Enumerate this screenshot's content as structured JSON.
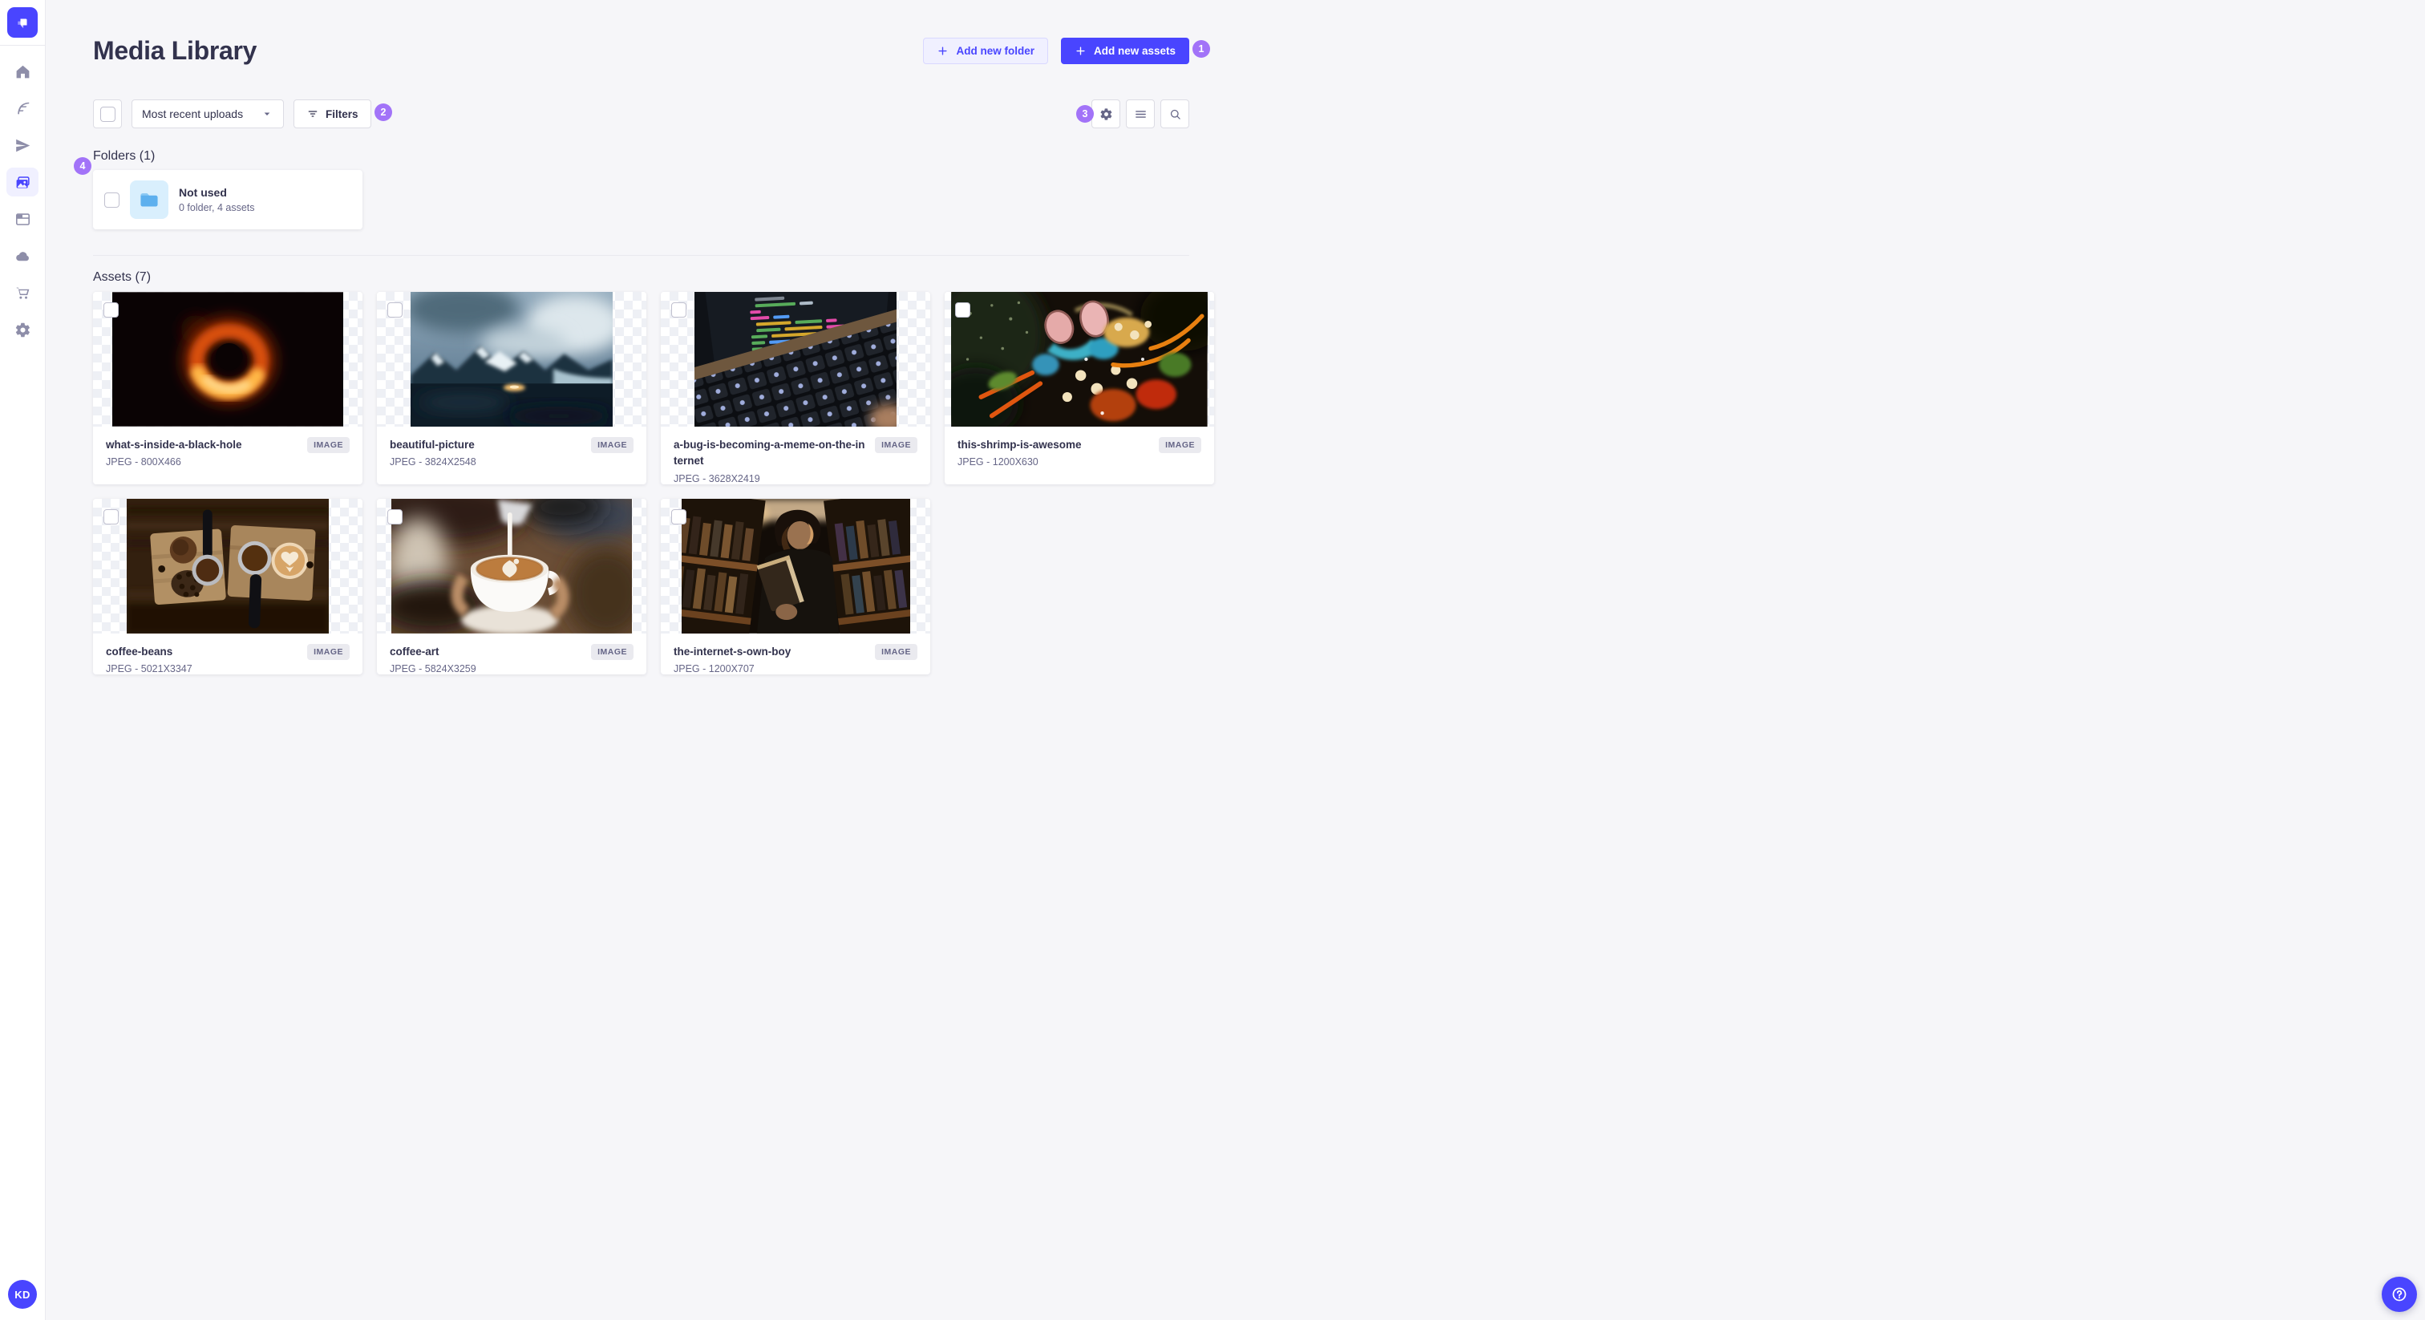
{
  "colors": {
    "accent": "#4945ff",
    "accent_light_bg": "#f0f0ff",
    "annotation_badge": "#a273f8",
    "page_bg": "#f6f6f9"
  },
  "sidebar": {
    "logo_icon": "strapi-logo",
    "nav": [
      {
        "icon": "home-icon",
        "active": false
      },
      {
        "icon": "feather-icon",
        "active": false
      },
      {
        "icon": "paper-plane-icon",
        "active": false
      },
      {
        "icon": "media-library-icon",
        "active": true
      },
      {
        "icon": "layout-icon",
        "active": false
      },
      {
        "icon": "cloud-icon",
        "active": false
      },
      {
        "icon": "cart-icon",
        "active": false
      },
      {
        "icon": "settings-icon",
        "active": false
      }
    ],
    "user_initials": "KD"
  },
  "header": {
    "title": "Media Library",
    "add_new_folder": "Add new folder",
    "add_new_assets": "Add new assets"
  },
  "toolbar": {
    "sort_selected": "Most recent uploads",
    "filters_label": "Filters",
    "right_icons": [
      "settings-icon",
      "list-icon",
      "search-icon"
    ]
  },
  "annotations": [
    {
      "label": "1"
    },
    {
      "label": "2"
    },
    {
      "label": "3"
    },
    {
      "label": "4"
    }
  ],
  "folders_section": {
    "heading": "Folders (1)",
    "items": [
      {
        "title": "Not used",
        "subtitle": "0 folder, 4 assets"
      }
    ]
  },
  "assets_section": {
    "heading": "Assets (7)",
    "items": [
      {
        "title": "what-s-inside-a-black-hole",
        "meta": "JPEG - 800X466",
        "type_badge": "IMAGE"
      },
      {
        "title": "beautiful-picture",
        "meta": "JPEG - 3824X2548",
        "type_badge": "IMAGE"
      },
      {
        "title": "a-bug-is-becoming-a-meme-on-the-internet",
        "meta": "JPEG - 3628X2419",
        "type_badge": "IMAGE"
      },
      {
        "title": "this-shrimp-is-awesome",
        "meta": "JPEG - 1200X630",
        "type_badge": "IMAGE"
      },
      {
        "title": "coffee-beans",
        "meta": "JPEG - 5021X3347",
        "type_badge": "IMAGE"
      },
      {
        "title": "coffee-art",
        "meta": "JPEG - 5824X3259",
        "type_badge": "IMAGE"
      },
      {
        "title": "the-internet-s-own-boy",
        "meta": "JPEG - 1200X707",
        "type_badge": "IMAGE"
      }
    ]
  },
  "user": {
    "initials": "KD"
  }
}
